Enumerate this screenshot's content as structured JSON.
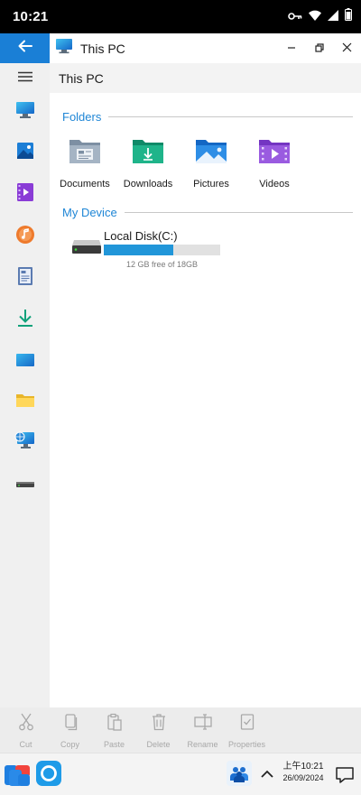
{
  "status_bar": {
    "time": "10:21",
    "icons": [
      "vpn-key-icon",
      "wifi-icon",
      "signal-icon",
      "battery-icon"
    ]
  },
  "window": {
    "title": "This PC",
    "controls": [
      "minimize-icon",
      "restore-icon",
      "close-icon"
    ]
  },
  "path": "This PC",
  "sidebar": {
    "items": [
      "this-pc-icon",
      "pictures-icon",
      "videos-icon",
      "music-icon",
      "documents-icon",
      "downloads-icon",
      "desktop-icon",
      "folder-icon",
      "network-icon",
      "drive-icon"
    ]
  },
  "sections": {
    "folders": "Folders",
    "device": "My Device"
  },
  "folders": [
    {
      "name": "Documents",
      "icon": "documents-folder-icon"
    },
    {
      "name": "Downloads",
      "icon": "downloads-folder-icon"
    },
    {
      "name": "Pictures",
      "icon": "pictures-folder-icon"
    },
    {
      "name": "Videos",
      "icon": "videos-folder-icon"
    }
  ],
  "drive": {
    "name": "Local Disk(C:)",
    "free_text": "12 GB free of 18GB",
    "used_fraction": 0.6
  },
  "toolbar": {
    "cut": "Cut",
    "copy": "Copy",
    "paste": "Paste",
    "delete": "Delete",
    "rename": "Rename",
    "properties": "Properties"
  },
  "taskbar": {
    "clock_time": "上午10:21",
    "clock_date": "26/09/2024"
  },
  "colors": {
    "accent": "#1a7fd6",
    "section_heading": "#1f86d6",
    "drive_bar": "#2196d9"
  }
}
